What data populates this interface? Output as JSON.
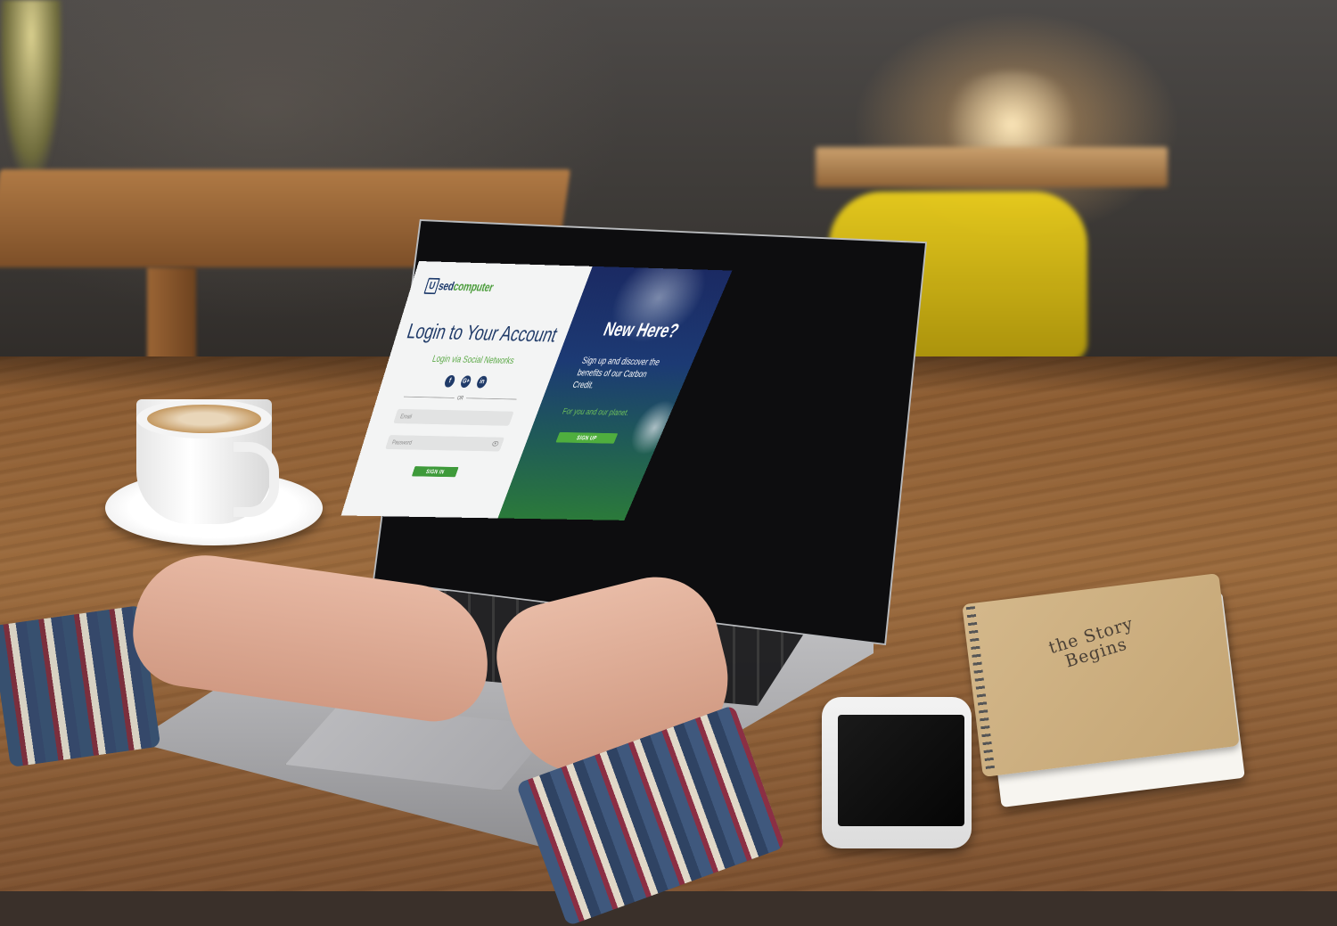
{
  "brand": {
    "logo_mark": "U",
    "logo_part1": "sed",
    "logo_part2": "computer"
  },
  "login": {
    "title": "Login to Your Account",
    "subtitle": "Login via Social Networks",
    "social_icons": [
      "facebook-icon",
      "google-plus-icon",
      "linkedin-icon"
    ],
    "social_glyphs": {
      "facebook": "f",
      "google_plus": "G+",
      "linkedin": "in"
    },
    "divider_text": "OR",
    "email_placeholder": "Email",
    "password_placeholder": "Password",
    "signin_label": "SIGN IN"
  },
  "promo": {
    "title": "New Here?",
    "description": "Sign up and discover the benefits of our Carbon Credit.",
    "tagline": "For you and our planet.",
    "signup_label": "SIGN UP"
  },
  "notebook": {
    "cover_text": "the Story Begins"
  },
  "colors": {
    "brand_blue": "#1f3a68",
    "brand_green": "#4a9c3a",
    "promo_gradient_top": "#1b2a63",
    "promo_gradient_bottom": "#2b7a3a"
  }
}
